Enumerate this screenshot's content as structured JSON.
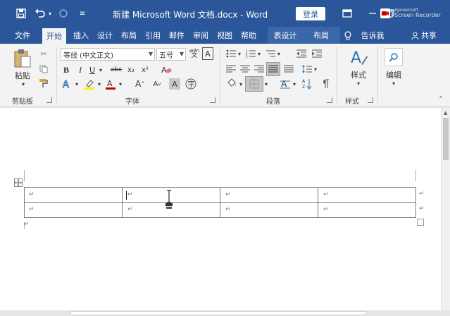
{
  "title": "新建 Microsoft Word 文档.docx  -  Word",
  "login": "登录",
  "recorder": [
    "Apowersoft",
    "Screen Recorder"
  ],
  "icons": {
    "save": "save-icon",
    "undo": "undo-icon",
    "redo": "redo-icon",
    "customize": "customize-icon",
    "ribbon_display": "ribbon-display-icon",
    "minimize": "minimize-icon",
    "restore": "restore-icon",
    "close": "close-icon",
    "tellme": "lightbulb-icon",
    "share": "share-icon"
  },
  "tabs": [
    "文件",
    "开始",
    "插入",
    "设计",
    "布局",
    "引用",
    "邮件",
    "审阅",
    "视图",
    "帮助",
    "表设计",
    "布局"
  ],
  "active_tab": "开始",
  "tellme": "告诉我",
  "share": "共享",
  "clipboard": {
    "paste": "粘贴",
    "label": "剪贴板"
  },
  "font": {
    "name": "等线 (中文正文)",
    "size": "五号",
    "label": "字体",
    "wen": "wén",
    "bold": "B",
    "italic": "I",
    "underline": "U",
    "strike": "abc",
    "sub": "x₂",
    "sup": "x²",
    "grow": "A",
    "shrink": "A",
    "highlight_color": "#ffee00",
    "font_color": "#d00000"
  },
  "paragraph": {
    "label": "段落"
  },
  "styles": {
    "label": "样式",
    "button": "样式"
  },
  "editing": {
    "label": "编辑",
    "button": "编辑"
  },
  "document": {
    "table": {
      "rows": 2,
      "cols": 4,
      "cell_mark": "↵"
    },
    "para_mark": "↵"
  }
}
